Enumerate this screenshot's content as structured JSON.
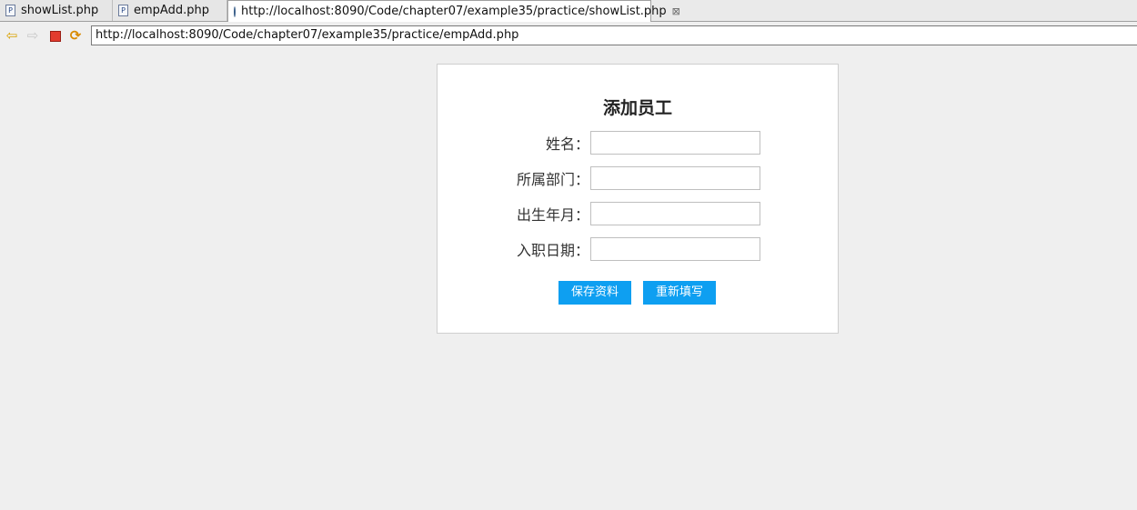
{
  "tabs": [
    {
      "label": "showList.php",
      "icon": "php-file-icon"
    },
    {
      "label": "empAdd.php",
      "icon": "php-file-icon"
    },
    {
      "label": "http://localhost:8090/Code/chapter07/example35/practice/showList.php",
      "icon": "globe-icon",
      "close_glyph": "⊠"
    }
  ],
  "toolbar": {
    "back_icon": "back-arrow-icon",
    "forward_icon": "forward-arrow-icon",
    "stop_icon": "stop-icon",
    "refresh_icon": "refresh-icon",
    "url": "http://localhost:8090/Code/chapter07/example35/practice/empAdd.php"
  },
  "form": {
    "title": "添加员工",
    "fields": [
      {
        "label": "姓名：",
        "value": ""
      },
      {
        "label": "所属部门：",
        "value": ""
      },
      {
        "label": "出生年月：",
        "value": ""
      },
      {
        "label": "入职日期：",
        "value": ""
      }
    ],
    "save_label": "保存资料",
    "reset_label": "重新填写"
  },
  "colors": {
    "button_bg": "#0e9ff1",
    "page_bg": "#efefef",
    "stop_red": "#e23b2e"
  }
}
